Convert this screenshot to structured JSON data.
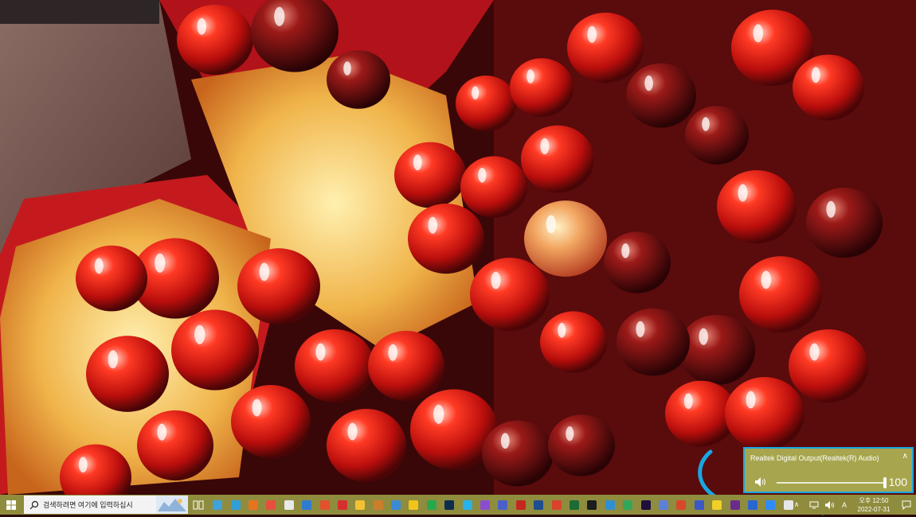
{
  "volume": {
    "device_name": "Realtek Digital Output(Realtek(R) Audio)",
    "level": 100,
    "level_text": "100",
    "expand_icon": "chevron-up-icon",
    "speaker_icon": "speaker-icon"
  },
  "taskbar": {
    "search_placeholder": "검색하려면 여기에 입력하십시",
    "apps": [
      {
        "name": "app-1",
        "color": "#3fa3d8"
      },
      {
        "name": "app-edge",
        "color": "#2f9fd8"
      },
      {
        "name": "app-firefox",
        "color": "#e8731e"
      },
      {
        "name": "app-chrome",
        "color": "#e84e3c"
      },
      {
        "name": "app-store",
        "color": "#e9e9e9"
      },
      {
        "name": "app-mail",
        "color": "#2f7bd0"
      },
      {
        "name": "app-office",
        "color": "#e2512c"
      },
      {
        "name": "app-acrobat",
        "color": "#d62f2f"
      },
      {
        "name": "app-explorer",
        "color": "#f2c233"
      },
      {
        "name": "app-9",
        "color": "#cc7d2a"
      },
      {
        "name": "app-10",
        "color": "#3a8ad6"
      },
      {
        "name": "app-11",
        "color": "#f0c419"
      },
      {
        "name": "app-12",
        "color": "#27a84d"
      },
      {
        "name": "app-photoshop",
        "color": "#0d2c4e"
      },
      {
        "name": "app-14",
        "color": "#2ab1e8"
      },
      {
        "name": "app-visualstudio",
        "color": "#8b4dd0"
      },
      {
        "name": "app-16",
        "color": "#4a60c8"
      },
      {
        "name": "app-filezilla",
        "color": "#c4271e"
      },
      {
        "name": "app-18",
        "color": "#1d4e8f"
      },
      {
        "name": "app-19",
        "color": "#d9432c"
      },
      {
        "name": "app-20",
        "color": "#1e6a35"
      },
      {
        "name": "app-terminal",
        "color": "#1d1d1d"
      },
      {
        "name": "app-22",
        "color": "#2e8fd2"
      },
      {
        "name": "app-23",
        "color": "#34a65a"
      },
      {
        "name": "app-premiere",
        "color": "#1f0f3f"
      },
      {
        "name": "app-25",
        "color": "#5e7fd8"
      },
      {
        "name": "app-26",
        "color": "#d8472b"
      },
      {
        "name": "app-27",
        "color": "#3a58c8"
      },
      {
        "name": "app-28",
        "color": "#f1cf26"
      },
      {
        "name": "app-29",
        "color": "#6a2c8c"
      },
      {
        "name": "app-30",
        "color": "#2a66d0"
      },
      {
        "name": "app-zoom",
        "color": "#2d8cff"
      },
      {
        "name": "app-32",
        "color": "#e6e6e6"
      }
    ],
    "tray": {
      "ime_label": "A",
      "clock_line1": "오후 12:50",
      "clock_line2": "2022-07-31"
    }
  },
  "colors": {
    "taskbar": "#8f8c3e",
    "flyout": "#a7a64e",
    "highlight": "#19a6e3"
  }
}
